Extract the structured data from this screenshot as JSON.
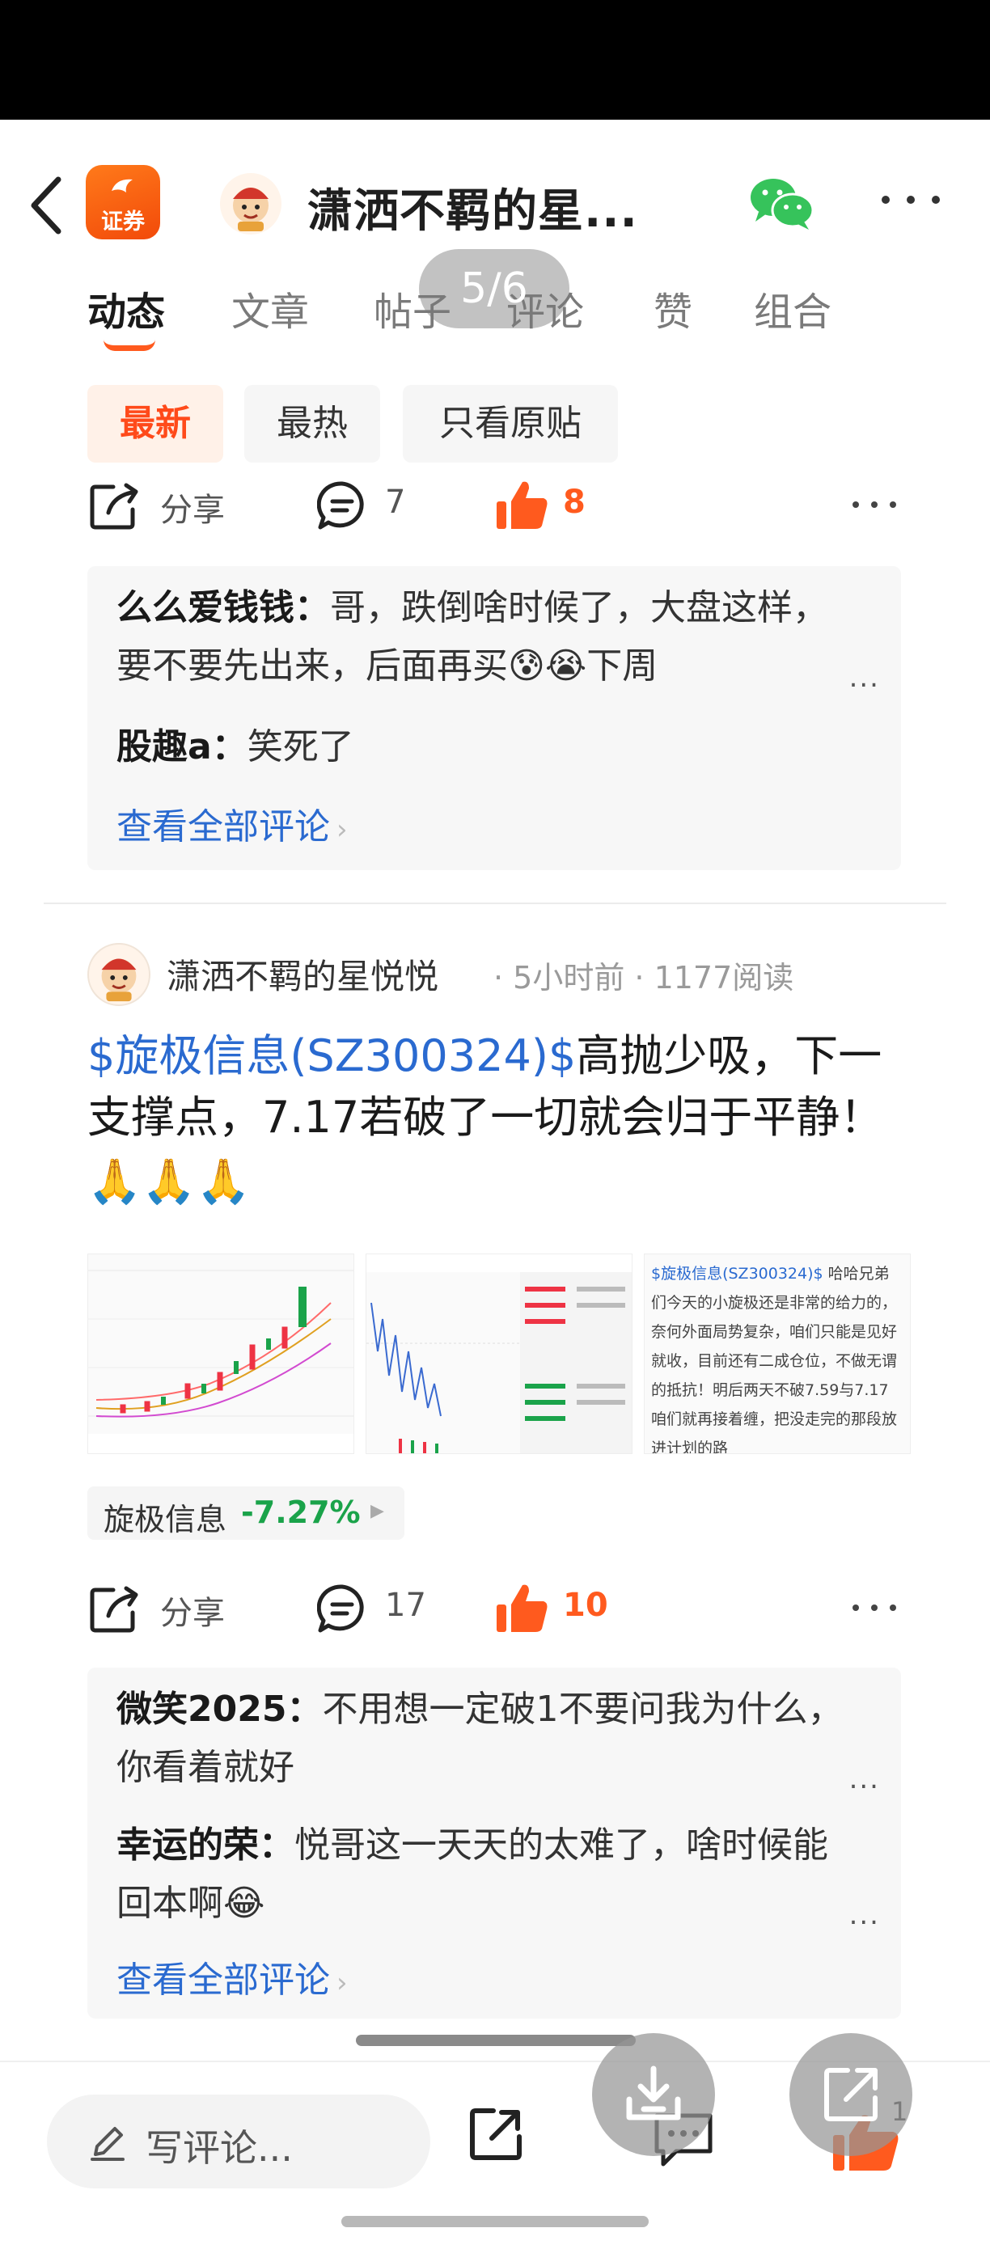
{
  "header": {
    "app_logo_label": "证券",
    "title": "潇洒不羁的星...",
    "back_icon": "chevron-left-icon",
    "wechat_icon": "wechat-icon",
    "more_icon": "more-horizontal-icon"
  },
  "tabs": [
    {
      "label": "动态",
      "active": true
    },
    {
      "label": "文章"
    },
    {
      "label": "帖子"
    },
    {
      "label": "评论"
    },
    {
      "label": "赞"
    },
    {
      "label": "组合"
    }
  ],
  "page_indicator": "5/6",
  "filters": [
    {
      "label": "最新",
      "active": true
    },
    {
      "label": "最热"
    },
    {
      "label": "只看原贴"
    }
  ],
  "post1": {
    "share_label": "分享",
    "comment_count": "7",
    "like_count": "8",
    "comments": [
      {
        "user": "么么爱钱钱：",
        "text": "哥，跌倒啥时候了，大盘这样，要不要先出来，后面再买😰😭下周"
      },
      {
        "user": "股趣a：",
        "text": "笑死了"
      }
    ],
    "see_all": "查看全部评论",
    "more_label": "..."
  },
  "post2": {
    "author": "潇洒不羁的星悦悦",
    "meta": "· 5小时前 · 1177阅读",
    "stock_link": "$旋极信息(SZ300324)$",
    "text": "高抛少吸，下一支撑点，7.17若破了一切就会归于平静！",
    "emojis": "🙏🙏🙏",
    "thumbnail3_stock": "$旋极信息(SZ300324)$",
    "thumbnail3_text": "哈哈兄弟们今天的小旋极还是非常的给力的，奈何外面局势复杂，咱们只能是见好就收，目前还有二成仓位，不做无谓的抵抗！明后两天不破7.59与7.17咱们就再接着缠，把没走完的那段放进计划的路",
    "stock_chip": {
      "name": "旋极信息",
      "change": "-7.27%"
    },
    "share_label": "分享",
    "comment_count": "17",
    "like_count": "10",
    "comments": [
      {
        "user": "微笑2025：",
        "text": "不用想一定破1不要问我为什么，你看着就好"
      },
      {
        "user": "幸运的荣：",
        "text": "悦哥这一天天的太难了，啥时候能回本啊😂"
      }
    ],
    "see_all": "查看全部评论",
    "more_label": "..."
  },
  "bottom_bar": {
    "write_comment": "写评论...",
    "like_count": "1"
  },
  "colors": {
    "accent": "#ff5a1e",
    "link": "#2a6ad0",
    "down": "#1aa34a"
  }
}
